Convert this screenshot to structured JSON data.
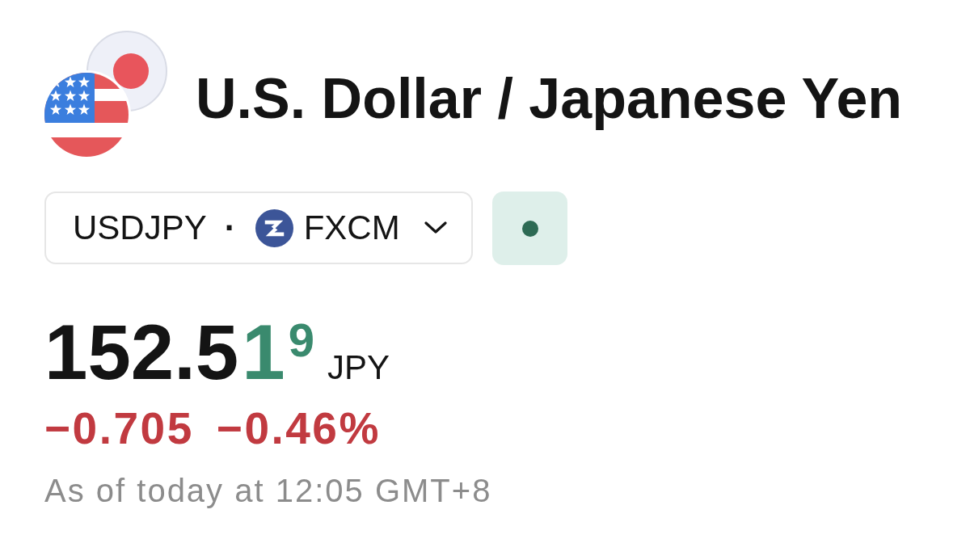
{
  "title": "U.S. Dollar / Japanese Yen",
  "symbol_selector": {
    "symbol": "USDJPY",
    "separator": "·",
    "exchange": "FXCM"
  },
  "status_button": {
    "active": true
  },
  "quote": {
    "price": {
      "base": "152.5",
      "highlight": "1",
      "pip": "9"
    },
    "tick_up": true,
    "currency": "JPY",
    "change": "−0.705",
    "change_percent": "−0.46%",
    "negative": true,
    "timestamp": "As of today at 12:05 GMT+8"
  }
}
